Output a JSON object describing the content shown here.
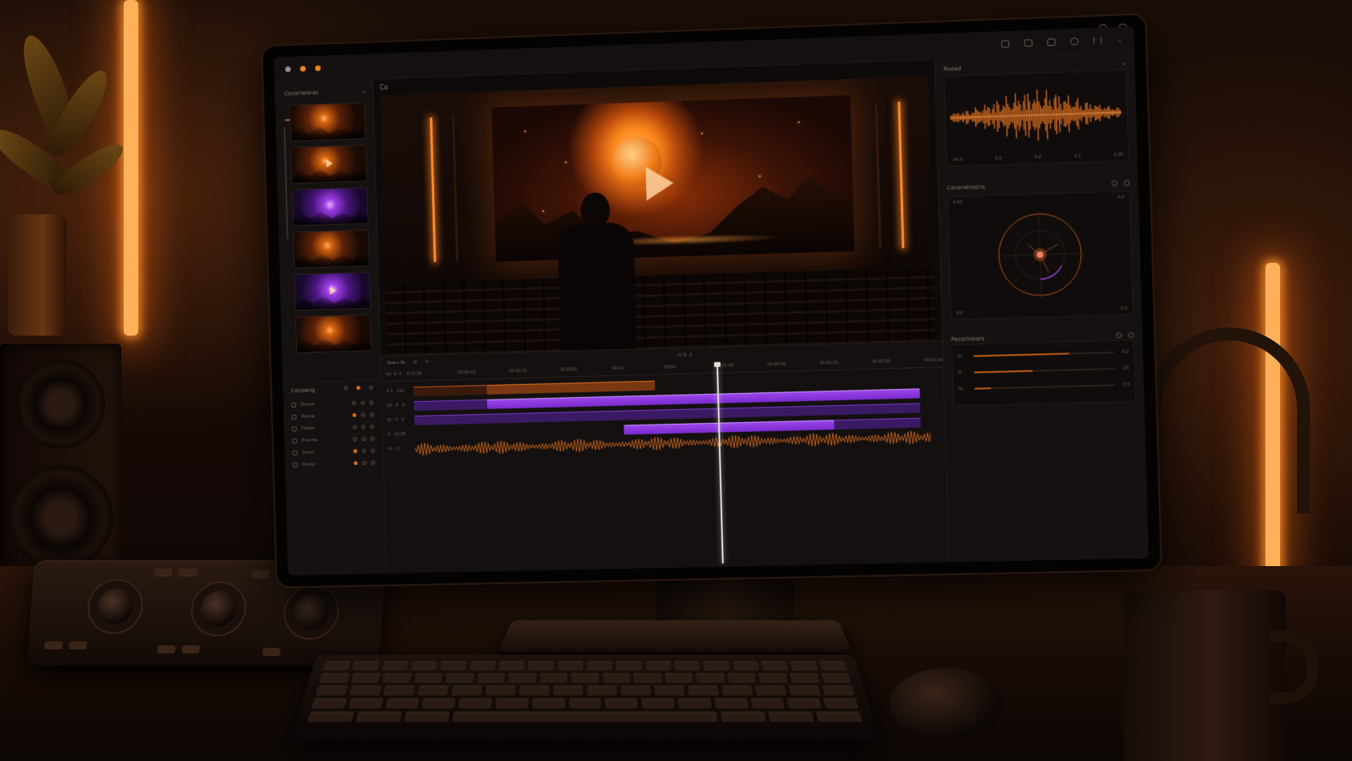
{
  "window": {
    "traffic_lights": [
      "#9a8e86",
      "#f0861f",
      "#f0861f"
    ],
    "toolbar_icons": [
      "audio-meter-icon",
      "capture-icon",
      "monitor-icon",
      "circle-icon",
      "split-icon",
      "chevron-down-icon"
    ]
  },
  "media_panel": {
    "title": "Cecarlaleras",
    "thumbnails": [
      {
        "tone": "orange",
        "icon": "thumbnail-image"
      },
      {
        "tone": "orange",
        "icon": "thumbnail-image"
      },
      {
        "tone": "purple",
        "icon": "thumbnail-image"
      },
      {
        "tone": "orange",
        "icon": "thumbnail-image"
      },
      {
        "tone": "purple",
        "icon": "thumbnail-image"
      },
      {
        "tone": "orange",
        "icon": "thumbnail-image"
      }
    ]
  },
  "layers_panel": {
    "title": "Cecoang",
    "rows": [
      {
        "name": "Reare",
        "active": false
      },
      {
        "name": "Reare",
        "active": true
      },
      {
        "name": "Fleter",
        "active": false
      },
      {
        "name": "Erarde",
        "active": false
      },
      {
        "name": "Seuri",
        "active": true
      },
      {
        "name": "Deap",
        "active": true
      }
    ]
  },
  "viewer": {
    "label": "Co"
  },
  "timeline": {
    "toolbar_label": "Sre→ Ri",
    "timecode": "-0·8 ·2",
    "ruler_label": "Ok ·9 ·4",
    "ticks": [
      "0:10:00",
      "00:00:00",
      "00:00:00",
      "00:0000",
      "00:00",
      "00:00",
      "00:01:00",
      "00:00:00",
      "00:00:00",
      "00:00:00",
      "00:00:00"
    ],
    "tracks": [
      {
        "label": "0:1 · 112"
      },
      {
        "label": "00 · 6 · 4"
      },
      {
        "label": "0r · 0 · 0"
      },
      {
        "label": "0 · 19:38"
      },
      {
        "label": "0c · 3"
      }
    ],
    "playhead_position": 0.59
  },
  "right_panel": {
    "waveform": {
      "title": "Rsead",
      "axis": [
        "-45.0",
        "0:0",
        "0:0",
        "1:1",
        "0:00"
      ]
    },
    "scope": {
      "title": "Cecerahlacra",
      "corners": [
        "0:02",
        "0:0",
        "0:0",
        "0:0"
      ]
    },
    "parameters": {
      "title": "Pecerhlears",
      "rows": [
        {
          "label": "0c",
          "value": 0.68,
          "readout": "0:0"
        },
        {
          "label": "0i",
          "value": 0.42,
          "readout": "2:5"
        },
        {
          "label": "0s",
          "value": 0.12,
          "readout": "2:3"
        }
      ]
    }
  },
  "colors": {
    "accent_orange": "#e0701e",
    "accent_purple": "#9a45e8",
    "panel_bg": "#151110"
  }
}
